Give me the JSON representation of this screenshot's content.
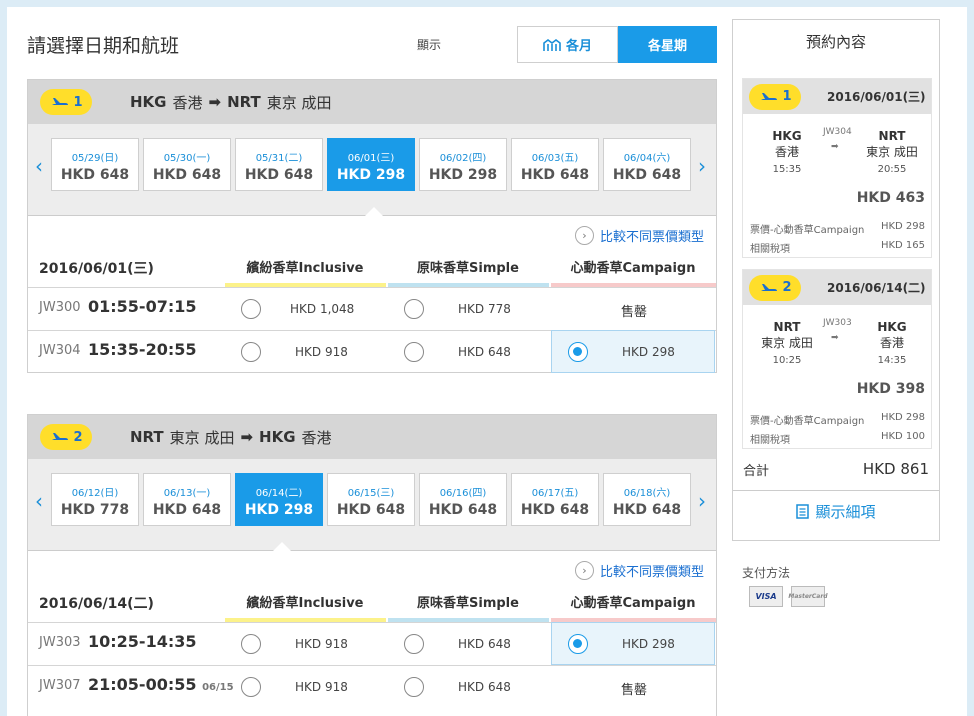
{
  "page_title": "請選擇日期和航班",
  "view": {
    "label": "顯示",
    "monthly": "各月",
    "weekly": "各星期"
  },
  "compare_label": "比較不同票價類型",
  "fare_headers": [
    "繽紛香草Inclusive",
    "原味香草Simple",
    "心動香草Campaign"
  ],
  "colors": {
    "inclusive": "#fcf28a",
    "simple": "#bfe2f0",
    "campaign": "#f7caca",
    "accent": "#1a9be8",
    "badge": "#ffde2a"
  },
  "legs": [
    {
      "num": "1",
      "origin_code": "HKG",
      "origin_name": "香港",
      "dest_code": "NRT",
      "dest_name": "東京 成田",
      "dates": [
        {
          "d": "05/29(日)",
          "p": "HKD 648"
        },
        {
          "d": "05/30(一)",
          "p": "HKD 648"
        },
        {
          "d": "05/31(二)",
          "p": "HKD 648"
        },
        {
          "d": "06/01(三)",
          "p": "HKD 298"
        },
        {
          "d": "06/02(四)",
          "p": "HKD 298"
        },
        {
          "d": "06/03(五)",
          "p": "HKD 648"
        },
        {
          "d": "06/04(六)",
          "p": "HKD 648"
        }
      ],
      "selected_date": "2016/06/01(三)",
      "flights": [
        {
          "no": "JW300",
          "time": "01:55-07:15",
          "next": "",
          "inclusive": "HKD 1,048",
          "simple": "HKD 778",
          "campaign": "售罄"
        },
        {
          "no": "JW304",
          "time": "15:35-20:55",
          "next": "",
          "inclusive": "HKD 918",
          "simple": "HKD 648",
          "campaign": "HKD 298"
        }
      ]
    },
    {
      "num": "2",
      "origin_code": "NRT",
      "origin_name": "東京 成田",
      "dest_code": "HKG",
      "dest_name": "香港",
      "dates": [
        {
          "d": "06/12(日)",
          "p": "HKD 778"
        },
        {
          "d": "06/13(一)",
          "p": "HKD 648"
        },
        {
          "d": "06/14(二)",
          "p": "HKD 298"
        },
        {
          "d": "06/15(三)",
          "p": "HKD 648"
        },
        {
          "d": "06/16(四)",
          "p": "HKD 648"
        },
        {
          "d": "06/17(五)",
          "p": "HKD 648"
        },
        {
          "d": "06/18(六)",
          "p": "HKD 648"
        }
      ],
      "selected_date": "2016/06/14(二)",
      "flights": [
        {
          "no": "JW303",
          "time": "10:25-14:35",
          "next": "",
          "inclusive": "HKD 918",
          "simple": "HKD 648",
          "campaign": "HKD 298"
        },
        {
          "no": "JW307",
          "time": "21:05-00:55",
          "next": "06/15",
          "inclusive": "HKD 918",
          "simple": "HKD 648",
          "campaign": "售罄"
        }
      ]
    }
  ],
  "summary": {
    "title": "預約內容",
    "legs": [
      {
        "num": "1",
        "date": "2016/06/01(三)",
        "from_code": "HKG",
        "from_name": "香港",
        "from_time": "15:35",
        "flight": "JW304",
        "to_code": "NRT",
        "to_name": "東京 成田",
        "to_time": "20:55",
        "total": "HKD 463",
        "fare_label": "票價-心動香草Campaign",
        "fare": "HKD 298",
        "tax_label": "相關稅項",
        "tax": "HKD 165"
      },
      {
        "num": "2",
        "date": "2016/06/14(二)",
        "from_code": "NRT",
        "from_name": "東京 成田",
        "from_time": "10:25",
        "flight": "JW303",
        "to_code": "HKG",
        "to_name": "香港",
        "to_time": "14:35",
        "total": "HKD 398",
        "fare_label": "票價-心動香草Campaign",
        "fare": "HKD 298",
        "tax_label": "相關稅項",
        "tax": "HKD 100"
      }
    ],
    "total_label": "合計",
    "total": "HKD 861",
    "details": "顯示細項"
  },
  "payment": {
    "label": "支付方法",
    "cards": [
      "VISA",
      "MasterCard"
    ]
  }
}
